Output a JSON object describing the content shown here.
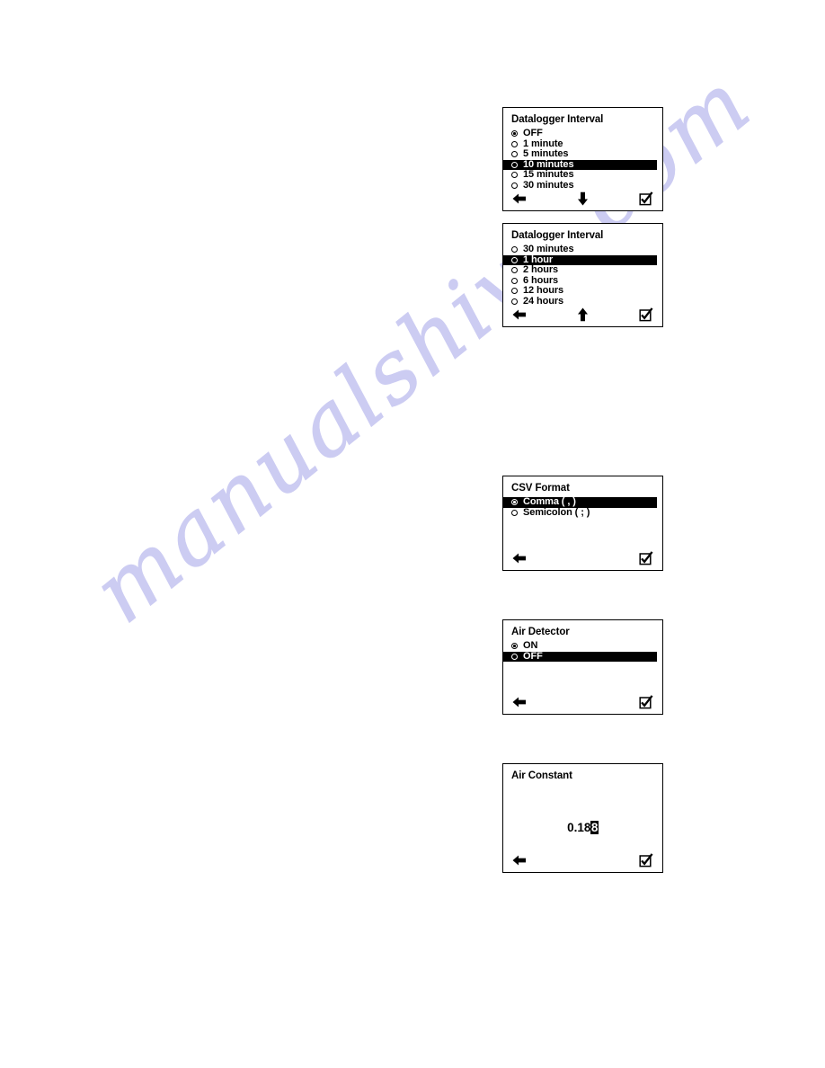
{
  "page": {
    "background_color": "#ffffff",
    "watermark_text": "manualshive.com",
    "watermark_color": "#ccccf2"
  },
  "icons": {
    "back_arrow": "arrow-left-icon",
    "scroll_down": "arrow-down-icon",
    "scroll_up": "arrow-up-icon",
    "confirm": "checkbox-checked-icon"
  },
  "screens": [
    {
      "id": "datalogger-interval-page1",
      "title": "Datalogger Interval",
      "type": "radio-list",
      "options": [
        {
          "label": "OFF",
          "checked": true,
          "highlighted": false
        },
        {
          "label": "1 minute",
          "checked": false,
          "highlighted": false
        },
        {
          "label": "5 minutes",
          "checked": false,
          "highlighted": false
        },
        {
          "label": "10 minutes",
          "checked": false,
          "highlighted": true
        },
        {
          "label": "15 minutes",
          "checked": false,
          "highlighted": false
        },
        {
          "label": "30 minutes",
          "checked": false,
          "highlighted": false
        }
      ],
      "softkeys": {
        "left": "arrow-left-icon",
        "middle": "arrow-down-icon",
        "right": "checkbox-checked-icon"
      }
    },
    {
      "id": "datalogger-interval-page2",
      "title": "Datalogger Interval",
      "type": "radio-list",
      "options": [
        {
          "label": "30 minutes",
          "checked": false,
          "highlighted": false
        },
        {
          "label": "1 hour",
          "checked": false,
          "highlighted": true
        },
        {
          "label": "2 hours",
          "checked": false,
          "highlighted": false
        },
        {
          "label": "6 hours",
          "checked": false,
          "highlighted": false
        },
        {
          "label": "12 hours",
          "checked": false,
          "highlighted": false
        },
        {
          "label": "24 hours",
          "checked": false,
          "highlighted": false
        }
      ],
      "softkeys": {
        "left": "arrow-left-icon",
        "middle": "arrow-up-icon",
        "right": "checkbox-checked-icon"
      }
    },
    {
      "id": "csv-format",
      "title": "CSV Format",
      "type": "radio-list",
      "options": [
        {
          "label": "Comma ( , )",
          "checked": true,
          "highlighted": true
        },
        {
          "label": "Semicolon ( ; )",
          "checked": false,
          "highlighted": false
        }
      ],
      "softkeys": {
        "left": "arrow-left-icon",
        "middle": null,
        "right": "checkbox-checked-icon"
      }
    },
    {
      "id": "air-detector",
      "title": "Air Detector",
      "type": "radio-list",
      "options": [
        {
          "label": "ON",
          "checked": true,
          "highlighted": false
        },
        {
          "label": "OFF",
          "checked": false,
          "highlighted": true
        }
      ],
      "softkeys": {
        "left": "arrow-left-icon",
        "middle": null,
        "right": "checkbox-checked-icon"
      }
    },
    {
      "id": "air-constant",
      "title": "Air Constant",
      "type": "value-editor",
      "value_prefix": "0.18",
      "value_cursor_digit": "8",
      "softkeys": {
        "left": "arrow-left-icon",
        "middle": null,
        "right": "checkbox-checked-icon"
      }
    }
  ]
}
